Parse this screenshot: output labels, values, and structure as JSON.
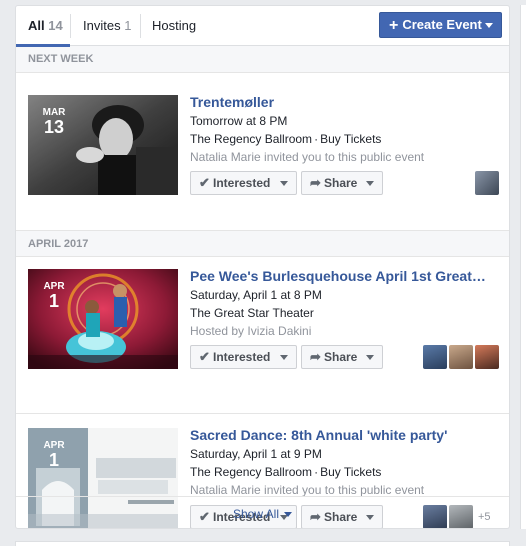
{
  "tabs": {
    "all": {
      "label": "All",
      "count": "14"
    },
    "invites": {
      "label": "Invites",
      "count": "1"
    },
    "hosting": {
      "label": "Hosting"
    }
  },
  "create_button": {
    "label": "Create Event",
    "icon": "plus-icon"
  },
  "sections": [
    {
      "label": "NEXT WEEK"
    },
    {
      "label": "APRIL 2017"
    }
  ],
  "events": [
    {
      "month": "MAR",
      "day": "13",
      "title": "Trentemøller",
      "when": "Tomorrow at 8 PM",
      "venue": "The Regency Ballroom",
      "tickets": "Buy Tickets",
      "note": "Natalia Marie invited you to this public event",
      "interested": "Interested",
      "share": "Share"
    },
    {
      "month": "APR",
      "day": "1",
      "title": "Pee Wee's Burlesquehouse April 1st Great…",
      "when": "Saturday, April 1 at 8 PM",
      "venue": "The Great Star Theater",
      "note": "Hosted by Ivizia Dakini",
      "interested": "Interested",
      "share": "Share"
    },
    {
      "month": "APR",
      "day": "1",
      "title": "Sacred Dance: 8th Annual 'white party'",
      "when": "Saturday, April 1 at 9 PM",
      "venue": "The Regency Ballroom",
      "tickets": "Buy Tickets",
      "note": "Natalia Marie invited you to this public event",
      "interested": "Interested",
      "share": "Share",
      "extra_guests": "+5"
    }
  ],
  "show_all": {
    "label": "Show All"
  },
  "colors": {
    "accent": "#4267b2",
    "link": "#365899",
    "muted": "#90949c"
  }
}
